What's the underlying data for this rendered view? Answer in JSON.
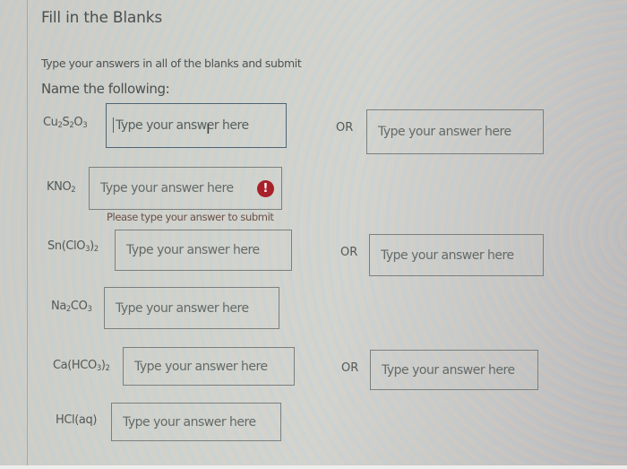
{
  "title": "Fill in the Blanks",
  "instructions": "Type your answers in all of the blanks and submit",
  "subheading": "Name the following:",
  "or_label": "OR",
  "placeholder": "Type your answer here",
  "error": {
    "message": "Please type your answer to submit",
    "icon": "exclamation-circle-icon",
    "icon_glyph": "!",
    "color": "#a8212a"
  },
  "questions": [
    {
      "formula": {
        "base": [
          "Cu",
          "S",
          "O"
        ],
        "subs": [
          "2",
          "2",
          "3"
        ],
        "tail": ""
      },
      "answer_value": "",
      "focused": true,
      "has_alternate": true,
      "alternate_value": ""
    },
    {
      "formula": {
        "base": [
          "KNO"
        ],
        "subs": [
          "2"
        ],
        "tail": ""
      },
      "answer_value": "",
      "error": true,
      "has_alternate": false
    },
    {
      "formula": {
        "base": [
          "Sn(ClO",
          ")"
        ],
        "subs": [
          "3",
          "2"
        ],
        "tail": ""
      },
      "answer_value": "",
      "has_alternate": true,
      "alternate_value": ""
    },
    {
      "formula": {
        "base": [
          "Na",
          "CO"
        ],
        "subs": [
          "2",
          "3"
        ],
        "tail": ""
      },
      "answer_value": "",
      "has_alternate": false
    },
    {
      "formula": {
        "base": [
          "Ca(HCO",
          ")"
        ],
        "subs": [
          "3",
          "2"
        ],
        "tail": ""
      },
      "answer_value": "",
      "has_alternate": true,
      "alternate_value": ""
    },
    {
      "formula": {
        "base": [
          "HCl(aq)"
        ],
        "subs": [
          ""
        ],
        "tail": ""
      },
      "answer_value": "",
      "has_alternate": false
    }
  ]
}
